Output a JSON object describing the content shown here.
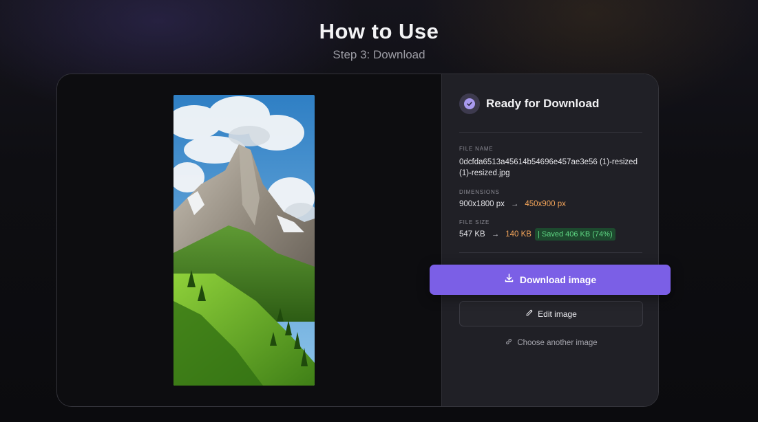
{
  "header": {
    "title": "How to Use",
    "subtitle": "Step 3: Download"
  },
  "preview": {
    "image_alt": "Mountain landscape with green valley"
  },
  "panel": {
    "status_title": "Ready for Download",
    "file_name_label": "FILE NAME",
    "file_name": "0dcfda6513a45614b54696e457ae3e56 (1)-resized (1)-resized.jpg",
    "dimensions_label": "DIMENSIONS",
    "dimensions_from": "900x1800 px",
    "dimensions_to": "450x900 px",
    "file_size_label": "FILE SIZE",
    "size_from": "547 KB",
    "size_to": "140 KB",
    "saved_badge": "| Saved 406 KB (74%)",
    "arrow": "→"
  },
  "actions": {
    "download_label": "Download image",
    "edit_label": "Edit image",
    "choose_label": "Choose another image"
  },
  "colors": {
    "accent": "#7b5fe6",
    "highlight": "#f4a55a",
    "success": "#5fd884"
  }
}
